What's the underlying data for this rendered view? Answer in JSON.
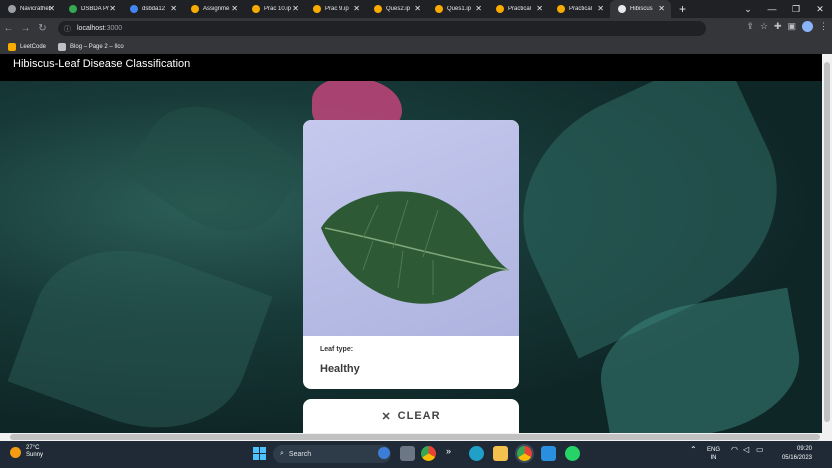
{
  "browser": {
    "tabs": [
      {
        "label": "Navicrather",
        "color": "#9aa0a6"
      },
      {
        "label": "DSBDA Pr",
        "color": "#34a853"
      },
      {
        "label": "dsbda12",
        "color": "#4285f4"
      },
      {
        "label": "Assignme",
        "color": "#f9ab00"
      },
      {
        "label": "Prac 10.ip",
        "color": "#f9ab00"
      },
      {
        "label": "Prac 9.ip",
        "color": "#f9ab00"
      },
      {
        "label": "Ques2.ip",
        "color": "#f9ab00"
      },
      {
        "label": "Ques1.ip",
        "color": "#f9ab00"
      },
      {
        "label": "Practical",
        "color": "#f9ab00"
      },
      {
        "label": "Practical",
        "color": "#f9ab00"
      },
      {
        "label": "Hibiscus",
        "color": "#e8eaed",
        "active": true
      }
    ],
    "url_host": "localhost",
    "url_port": ":3000",
    "bookmarks": [
      {
        "label": "LeetCode",
        "color": "#f9ab00"
      },
      {
        "label": "Blog – Page 2 – Ilco",
        "color": "#bdc1c6"
      }
    ]
  },
  "app": {
    "title": "Hibiscus-Leaf Disease Classification",
    "result_label": "Leaf type:",
    "result_value": "Healthy",
    "clear_label": "CLEAR",
    "close_glyph": "✕"
  },
  "taskbar": {
    "temperature": "27°C",
    "condition": "Sunny",
    "search_label": "Search",
    "language": "ENG",
    "region": "IN",
    "time": "09:20",
    "date": "05/16/2023"
  }
}
